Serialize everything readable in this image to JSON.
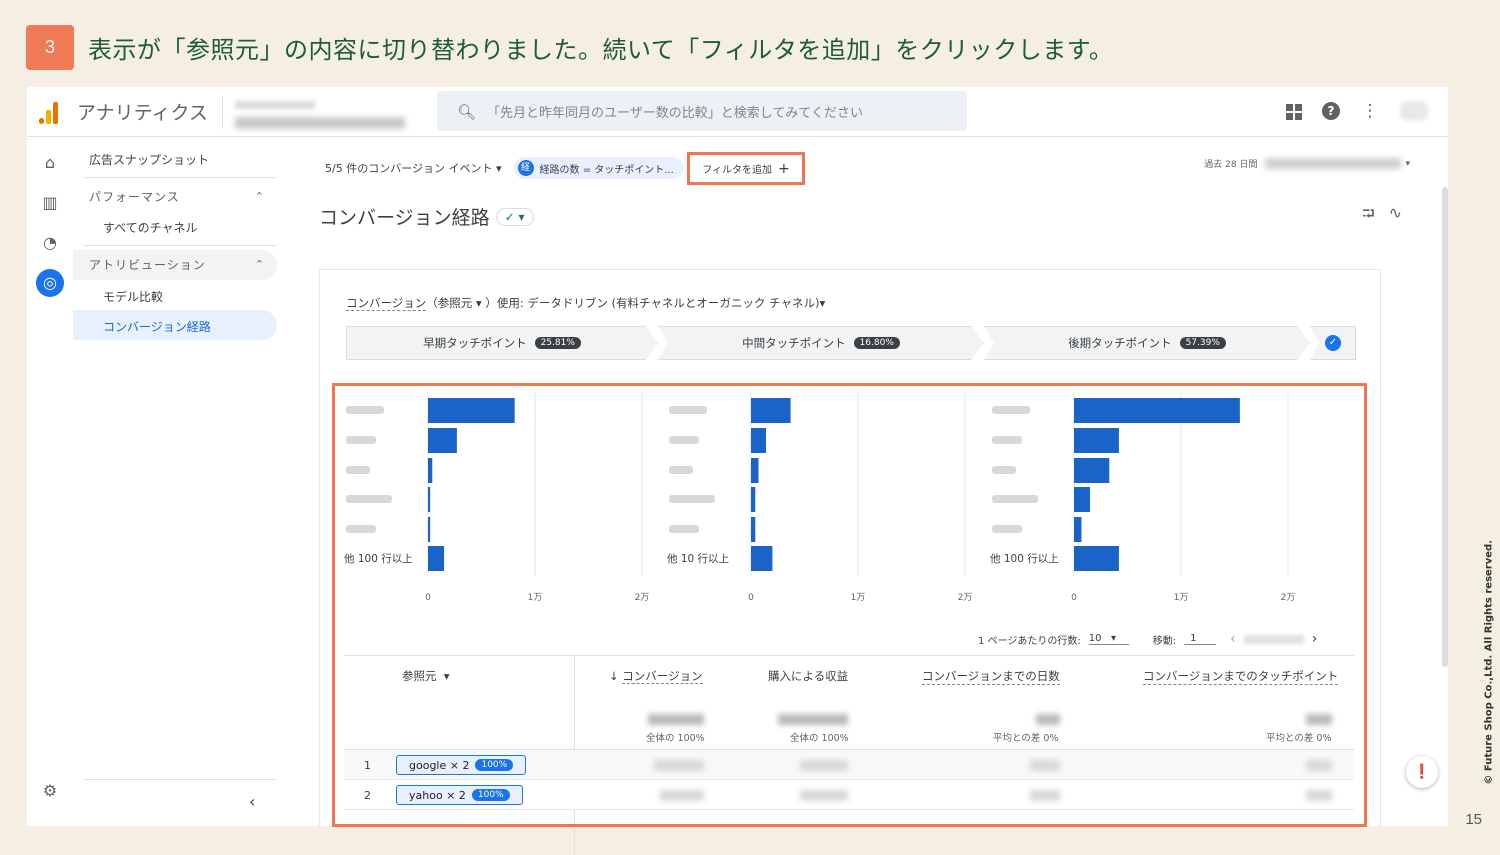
{
  "slide": {
    "step": "3",
    "title": "表示が「参照元」の内容に切り替わりました。続いて「フィルタを追加」をクリックします。",
    "copyright": "© Future Shop Co.,Ltd. All Rights reserved.",
    "page_number": "15"
  },
  "app": {
    "name": "アナリティクス",
    "search_placeholder": "「先月と昨年同月のユーザー数の比較」と検索してみてください"
  },
  "sidebar": {
    "snapshot": "広告スナップショット",
    "performance": "パフォーマンス",
    "all_channels": "すべてのチャネル",
    "attribution": "アトリビューション",
    "model_compare": "モデル比較",
    "conversion_paths": "コンバージョン経路"
  },
  "filterbar": {
    "events": "5/5 件のコンバージョン イベント",
    "chip_icon": "経",
    "chip_label": "経路の数 = タッチポイント...",
    "add_filter": "フィルタを追加",
    "date_label": "過去 28 日間"
  },
  "report": {
    "title": "コンバージョン経路",
    "conversion_label": "コンバージョン",
    "conversion_rest": "（参照元 ▾ ）使用: データドリブン (有料チャネルとオーガニック チャネル)▾"
  },
  "stages": [
    {
      "label": "早期タッチポイント",
      "pct": "25.81%"
    },
    {
      "label": "中間タッチポイント",
      "pct": "16.80%"
    },
    {
      "label": "後期タッチポイント",
      "pct": "57.39%"
    }
  ],
  "chart_data": {
    "type": "bar",
    "axis_ticks": [
      "0",
      "1万",
      "2万"
    ],
    "xlim": [
      0,
      20000
    ],
    "panels": [
      {
        "others_label": "他 100 行以上",
        "values": [
          8100,
          2700,
          400,
          200,
          200,
          1500
        ]
      },
      {
        "others_label": "他 10 行以上",
        "values": [
          3700,
          1400,
          700,
          400,
          400,
          2000
        ]
      },
      {
        "others_label": "他 100 行以上",
        "values": [
          15500,
          4200,
          3300,
          1500,
          700,
          4200
        ]
      }
    ]
  },
  "pager": {
    "rows_label": "1 ページあたりの行数:",
    "rows_value": "10",
    "goto_label": "移動:",
    "goto_value": "1"
  },
  "table": {
    "columns": [
      "参照元",
      "コンバージョン",
      "購入による収益",
      "コンバージョンまでの日数",
      "コンバージョンまでのタッチポイント"
    ],
    "total_conv_sub": "全体の 100%",
    "total_rev_sub": "全体の 100%",
    "avg_days_sub": "平均との差 0%",
    "avg_touch_sub": "平均との差 0%",
    "rows": [
      {
        "idx": "1",
        "path": "google × 2",
        "pct": "100%"
      },
      {
        "idx": "2",
        "path": "yahoo × 2",
        "pct": "100%"
      }
    ]
  }
}
